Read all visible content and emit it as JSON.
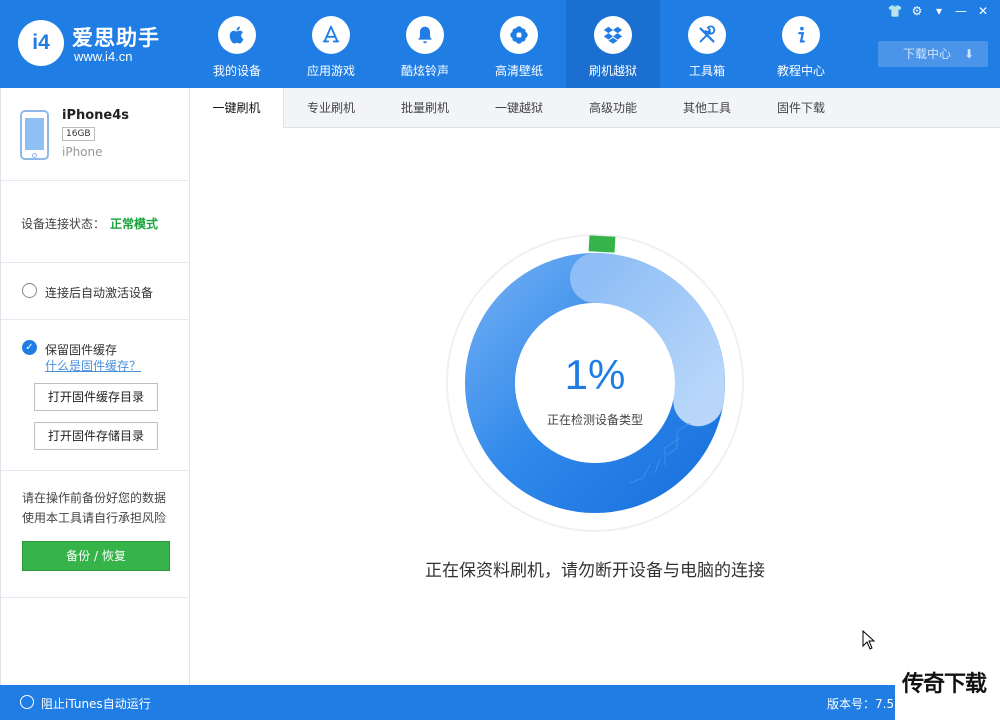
{
  "app": {
    "logo_title": "爱思助手",
    "logo_url": "www.i4.cn",
    "logo_mark": "i4"
  },
  "nav": [
    {
      "label": "我的设备",
      "icon": "apple-icon"
    },
    {
      "label": "应用游戏",
      "icon": "app-store-icon"
    },
    {
      "label": "酷炫铃声",
      "icon": "bell-icon"
    },
    {
      "label": "高清壁纸",
      "icon": "flower-icon"
    },
    {
      "label": "刷机越狱",
      "icon": "dropbox-icon",
      "active": true
    },
    {
      "label": "工具箱",
      "icon": "tools-icon"
    },
    {
      "label": "教程中心",
      "icon": "info-icon"
    }
  ],
  "window_controls": [
    "shirt-icon",
    "gear-icon",
    "menu-icon",
    "minimize-icon",
    "close-icon"
  ],
  "download_center": {
    "label": "下载中心"
  },
  "device": {
    "name": "iPhone4s",
    "capacity": "16GB",
    "type": "iPhone"
  },
  "status": {
    "label": "设备连接状态：",
    "value": "正常模式",
    "value_color": "#1aa33d"
  },
  "options": {
    "auto_activate": "连接后自动激活设备",
    "keep_cache": "保留固件缓存",
    "what_is_cache": "什么是固件缓存？",
    "open_cache_dir": "打开固件缓存目录",
    "open_storage_dir": "打开固件存储目录"
  },
  "warning": {
    "line1": "请在操作前备份好您的数据",
    "line2": "使用本工具请自行承担风险",
    "backup_button": "备份 / 恢复"
  },
  "tabs": [
    "一键刷机",
    "专业刷机",
    "批量刷机",
    "一键越狱",
    "高级功能",
    "其他工具",
    "固件下载"
  ],
  "progress": {
    "percent_text": "1%",
    "percent_value": 0.01,
    "substatus": "正在检测设备类型",
    "message": "正在保资料刷机，请勿断开设备与电脑的连接"
  },
  "bottom": {
    "itunes_label": "阻止iTunes自动运行",
    "version": "版本号：7.53"
  },
  "watermark": "传奇下载",
  "colors": {
    "primary": "#1f7de4",
    "green": "#36b449",
    "ring_light": "#9dc8f7",
    "ring_dark": "#1f7de4"
  }
}
